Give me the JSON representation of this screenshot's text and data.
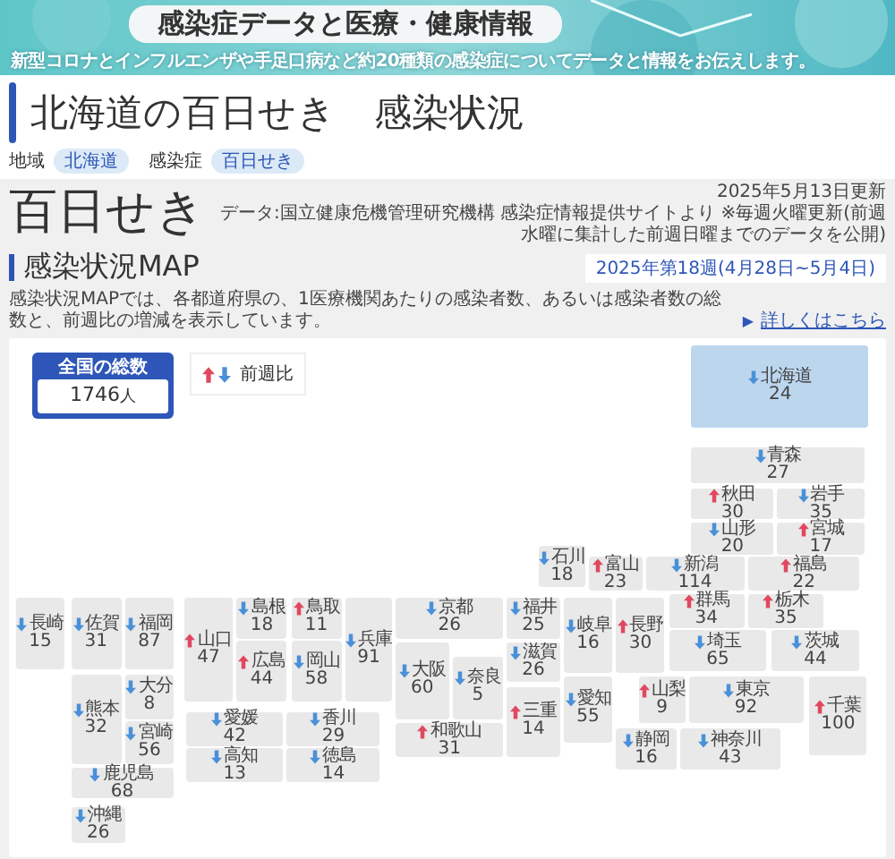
{
  "banner": {
    "title": "感染症データと医療・健康情報",
    "subtitle": "新型コロナとインフルエンザや手足口病など約20種類の感染症についてデータと情報をお伝えします。"
  },
  "page_title": "北海道の百日せき　感染状況",
  "filters": [
    {
      "label": "地域",
      "value": "北海道"
    },
    {
      "label": "感染症",
      "value": "百日せき"
    }
  ],
  "disease": "百日せき",
  "updated": "2025年5月13日更新",
  "source": "データ:国立健康危機管理研究機構 感染症情報提供サイトより ※毎週火曜更新(前週水曜に集計した前週日曜までのデータを公開)",
  "map_heading": "感染状況MAP",
  "week": "2025年第18週(4月28日~5月4日)",
  "description": "感染状況MAPでは、各都道府県の、1医療機関あたりの感染者数、あるいは感染者数の総数と、前週比の増減を表示しています。",
  "link": {
    "marker": "▶",
    "label": "詳しくはこちら"
  },
  "map": {
    "total": {
      "label": "全国の総数",
      "value": "1746",
      "unit": "人"
    },
    "legend": {
      "label": "前週比"
    },
    "prefectures": [
      {
        "name": "北海道",
        "value": "24",
        "rising": false,
        "selected": true
      },
      {
        "name": "青森",
        "value": "27",
        "rising": false,
        "selected": false
      },
      {
        "name": "秋田",
        "value": "30",
        "rising": true,
        "selected": false
      },
      {
        "name": "岩手",
        "value": "35",
        "rising": false,
        "selected": false
      },
      {
        "name": "山形",
        "value": "20",
        "rising": false,
        "selected": false
      },
      {
        "name": "宮城",
        "value": "17",
        "rising": true,
        "selected": false
      },
      {
        "name": "石川",
        "value": "18",
        "rising": false,
        "selected": false
      },
      {
        "name": "富山",
        "value": "23",
        "rising": true,
        "selected": false
      },
      {
        "name": "新潟",
        "value": "114",
        "rising": false,
        "selected": false
      },
      {
        "name": "福島",
        "value": "22",
        "rising": true,
        "selected": false
      },
      {
        "name": "福井",
        "value": "25",
        "rising": false,
        "selected": false
      },
      {
        "name": "岐阜",
        "value": "16",
        "rising": false,
        "selected": false
      },
      {
        "name": "長野",
        "value": "30",
        "rising": true,
        "selected": false
      },
      {
        "name": "群馬",
        "value": "34",
        "rising": true,
        "selected": false
      },
      {
        "name": "栃木",
        "value": "35",
        "rising": true,
        "selected": false
      },
      {
        "name": "埼玉",
        "value": "65",
        "rising": false,
        "selected": false
      },
      {
        "name": "茨城",
        "value": "44",
        "rising": false,
        "selected": false
      },
      {
        "name": "滋賀",
        "value": "26",
        "rising": false,
        "selected": false
      },
      {
        "name": "三重",
        "value": "14",
        "rising": true,
        "selected": false
      },
      {
        "name": "愛知",
        "value": "55",
        "rising": false,
        "selected": false
      },
      {
        "name": "山梨",
        "value": "9",
        "rising": true,
        "selected": false
      },
      {
        "name": "東京",
        "value": "92",
        "rising": false,
        "selected": false
      },
      {
        "name": "千葉",
        "value": "100",
        "rising": true,
        "selected": false
      },
      {
        "name": "静岡",
        "value": "16",
        "rising": false,
        "selected": false
      },
      {
        "name": "神奈川",
        "value": "43",
        "rising": false,
        "selected": false
      },
      {
        "name": "京都",
        "value": "26",
        "rising": false,
        "selected": false
      },
      {
        "name": "大阪",
        "value": "60",
        "rising": false,
        "selected": false
      },
      {
        "name": "奈良",
        "value": "5",
        "rising": false,
        "selected": false
      },
      {
        "name": "和歌山",
        "value": "31",
        "rising": true,
        "selected": false
      },
      {
        "name": "兵庫",
        "value": "91",
        "rising": false,
        "selected": false
      },
      {
        "name": "島根",
        "value": "18",
        "rising": false,
        "selected": false
      },
      {
        "name": "鳥取",
        "value": "11",
        "rising": true,
        "selected": false
      },
      {
        "name": "山口",
        "value": "47",
        "rising": true,
        "selected": false
      },
      {
        "name": "広島",
        "value": "44",
        "rising": true,
        "selected": false
      },
      {
        "name": "岡山",
        "value": "58",
        "rising": false,
        "selected": false
      },
      {
        "name": "愛媛",
        "value": "42",
        "rising": false,
        "selected": false
      },
      {
        "name": "香川",
        "value": "29",
        "rising": false,
        "selected": false
      },
      {
        "name": "高知",
        "value": "13",
        "rising": false,
        "selected": false
      },
      {
        "name": "徳島",
        "value": "14",
        "rising": false,
        "selected": false
      },
      {
        "name": "長崎",
        "value": "15",
        "rising": false,
        "selected": false
      },
      {
        "name": "佐賀",
        "value": "31",
        "rising": false,
        "selected": false
      },
      {
        "name": "福岡",
        "value": "87",
        "rising": false,
        "selected": false
      },
      {
        "name": "熊本",
        "value": "32",
        "rising": false,
        "selected": false
      },
      {
        "name": "大分",
        "value": "8",
        "rising": false,
        "selected": false
      },
      {
        "name": "宮崎",
        "value": "56",
        "rising": false,
        "selected": false
      },
      {
        "name": "鹿児島",
        "value": "68",
        "rising": false,
        "selected": false
      },
      {
        "name": "沖縄",
        "value": "26",
        "rising": false,
        "selected": false
      }
    ]
  }
}
